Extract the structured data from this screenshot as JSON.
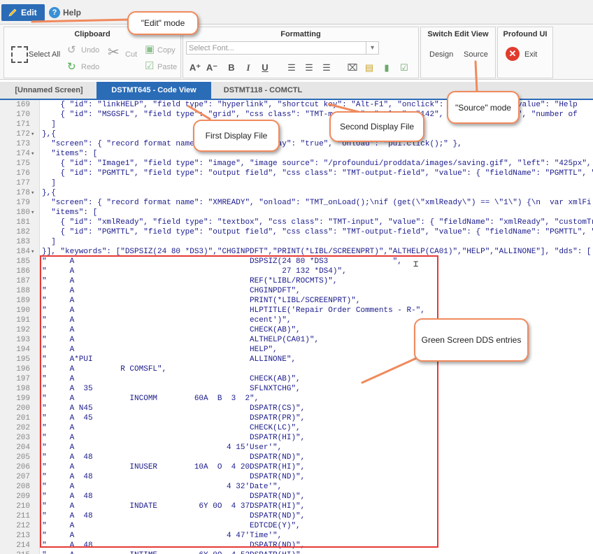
{
  "menu": {
    "edit": "Edit",
    "help": "Help"
  },
  "ribbon": {
    "clipboard": {
      "title": "Clipboard",
      "select_all": "Select All",
      "undo": "Undo",
      "redo": "Redo",
      "cut": "Cut",
      "copy": "Copy",
      "paste": "Paste"
    },
    "formatting": {
      "title": "Formatting",
      "font_placeholder": "Select Font..."
    },
    "switch": {
      "title": "Switch Edit View",
      "design": "Design",
      "source": "Source"
    },
    "profound": {
      "title": "Profound UI",
      "exit": "Exit"
    }
  },
  "tabs": [
    {
      "label": "[Unnamed Screen]"
    },
    {
      "label": "DSTMT645 - Code View"
    },
    {
      "label": "DSTMT118 - COMCTL"
    }
  ],
  "code_lines": [
    {
      "n": "169",
      "fold": "",
      "t": "    { \"id\": \"linkHELP\", \"field type\": \"hyperlink\", \"shortcut key\": \"Alt-F1\", \"onclick\": \"pui.click(\", \"value\": \"Help"
    },
    {
      "n": "170",
      "fold": "",
      "t": "    { \"id\": \"MSGSFL\", \"field type\": \"grid\", \"css class\": \"TMT-message\", \"value\": \"142\", \"width\": \"583px\", \"number of"
    },
    {
      "n": "171",
      "fold": "",
      "t": "  ]"
    },
    {
      "n": "172",
      "fold": "▾",
      "t": "},{"
    },
    {
      "n": "173",
      "fold": "",
      "t": "  \"screen\": { \"record format name\": \"DUMMY\", \"overlay\": \"true\", \"onload\": \"pui.click();\" },"
    },
    {
      "n": "174",
      "fold": "▾",
      "t": "  \"items\": ["
    },
    {
      "n": "175",
      "fold": "",
      "t": "    { \"id\": \"Image1\", \"field type\": \"image\", \"image source\": \"/profoundui/proddata/images/saving.gif\", \"left\": \"425px\","
    },
    {
      "n": "176",
      "fold": "",
      "t": "    { \"id\": \"PGMTTL\", \"field type\": \"output field\", \"css class\": \"TMT-output-field\", \"value\": { \"fieldName\": \"PGMTTL\", \""
    },
    {
      "n": "177",
      "fold": "",
      "t": "  ]"
    },
    {
      "n": "178",
      "fold": "▾",
      "t": "},{"
    },
    {
      "n": "179",
      "fold": "",
      "t": "  \"screen\": { \"record format name\": \"XMREADY\", \"onload\": \"TMT_onLoad();\\nif (get(\\\"xmlReady\\\") == \\\"1\\\") {\\n  var xmlFi"
    },
    {
      "n": "180",
      "fold": "▾",
      "t": "  \"items\": ["
    },
    {
      "n": "181",
      "fold": "",
      "t": "    { \"id\": \"xmlReady\", \"field type\": \"textbox\", \"css class\": \"TMT-input\", \"value\": { \"fieldName\": \"xmlReady\", \"customTr"
    },
    {
      "n": "182",
      "fold": "",
      "t": "    { \"id\": \"PGMTTL\", \"field type\": \"output field\", \"css class\": \"TMT-output-field\", \"value\": { \"fieldName\": \"PGMTTL\", \""
    },
    {
      "n": "183",
      "fold": "",
      "t": "  ]"
    },
    {
      "n": "184",
      "fold": "▾",
      "t": "}], \"keywords\": [\"DSPSIZ(24 80 *DS3)\",\"CHGINPDFT\",\"PRINT(*LIBL/SCREENPRT)\",\"ALTHELP(CA01)\",\"HELP\",\"ALLINONE\"], \"dds\": ["
    },
    {
      "n": "185",
      "fold": "",
      "t": "\"     A                                      DSPSIZ(24 80 *DS3              \","
    },
    {
      "n": "186",
      "fold": "",
      "t": "\"     A                                             27 132 *DS4)\","
    },
    {
      "n": "187",
      "fold": "",
      "t": "\"     A                                      REF(*LIBL/ROCMTS)\","
    },
    {
      "n": "188",
      "fold": "",
      "t": "\"     A                                      CHGINPDFT\","
    },
    {
      "n": "189",
      "fold": "",
      "t": "\"     A                                      PRINT(*LIBL/SCREENPRT)\","
    },
    {
      "n": "190",
      "fold": "",
      "t": "\"     A                                      HLPTITLE('Repair Order Comments - R-\","
    },
    {
      "n": "191",
      "fold": "",
      "t": "\"     A                                      ecent')\","
    },
    {
      "n": "192",
      "fold": "",
      "t": "\"     A                                      CHECK(AB)\","
    },
    {
      "n": "193",
      "fold": "",
      "t": "\"     A                                      ALTHELP(CA01)\","
    },
    {
      "n": "194",
      "fold": "",
      "t": "\"     A                                      HELP\","
    },
    {
      "n": "195",
      "fold": "",
      "t": "\"     A*PUI                                  ALLINONE\","
    },
    {
      "n": "196",
      "fold": "",
      "t": "\"     A          R COMSFL\","
    },
    {
      "n": "197",
      "fold": "",
      "t": "\"     A                                      CHECK(AB)\","
    },
    {
      "n": "198",
      "fold": "",
      "t": "\"     A  35                                  SFLNXTCHG\","
    },
    {
      "n": "199",
      "fold": "",
      "t": "\"     A            INCOMM        60A  B  3  2\","
    },
    {
      "n": "200",
      "fold": "",
      "t": "\"     A N45                                  DSPATR(CS)\","
    },
    {
      "n": "201",
      "fold": "",
      "t": "\"     A  45                                  DSPATR(PR)\","
    },
    {
      "n": "202",
      "fold": "",
      "t": "\"     A                                      CHECK(LC)\","
    },
    {
      "n": "203",
      "fold": "",
      "t": "\"     A                                      DSPATR(HI)\","
    },
    {
      "n": "204",
      "fold": "",
      "t": "\"     A                                 4 15'User'\","
    },
    {
      "n": "205",
      "fold": "",
      "t": "\"     A  48                                  DSPATR(ND)\","
    },
    {
      "n": "206",
      "fold": "",
      "t": "\"     A            INUSER        10A  O  4 20DSPATR(HI)\","
    },
    {
      "n": "207",
      "fold": "",
      "t": "\"     A  48                                  DSPATR(ND)\","
    },
    {
      "n": "208",
      "fold": "",
      "t": "\"     A                                 4 32'Date'\","
    },
    {
      "n": "209",
      "fold": "",
      "t": "\"     A  48                                  DSPATR(ND)\","
    },
    {
      "n": "210",
      "fold": "",
      "t": "\"     A            INDATE         6Y 0O  4 37DSPATR(HI)\","
    },
    {
      "n": "211",
      "fold": "",
      "t": "\"     A  48                                  DSPATR(ND)\","
    },
    {
      "n": "212",
      "fold": "",
      "t": "\"     A                                      EDTCDE(Y)\","
    },
    {
      "n": "213",
      "fold": "",
      "t": "\"     A                                 4 47'Time'\","
    },
    {
      "n": "214",
      "fold": "",
      "t": "\"     A  48                                  DSPATR(ND)\","
    },
    {
      "n": "215",
      "fold": "",
      "t": "\"     A            INTIME         6Y 0O  4 52DSPATR(HI)\","
    }
  ],
  "callouts": {
    "edit_mode": "\"Edit\" mode",
    "first_display_file": "First Display File",
    "second_display_file": "Second Display File",
    "source_mode": "\"Source\" mode",
    "green_screen": "Green Screen DDS entries"
  },
  "colors": {
    "accent": "#2b6cb7",
    "callout_border": "#f08a5d",
    "highlight_box": "#e53935",
    "code_text": "#1a1a8c"
  }
}
